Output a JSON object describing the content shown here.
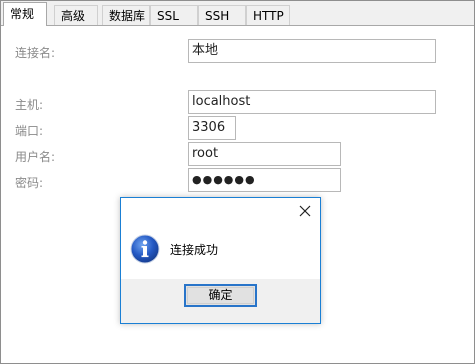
{
  "tabs": [
    {
      "label": "常规",
      "active": true
    },
    {
      "label": "高级",
      "active": false
    },
    {
      "label": "数据库",
      "active": false
    },
    {
      "label": "SSL",
      "active": false
    },
    {
      "label": "SSH",
      "active": false
    },
    {
      "label": "HTTP",
      "active": false
    }
  ],
  "form": {
    "connection_name_label": "连接名:",
    "connection_name_value": "本地",
    "host_label": "主机:",
    "host_value": "localhost",
    "port_label": "端口:",
    "port_value": "3306",
    "username_label": "用户名:",
    "username_value": "root",
    "password_label": "密码:",
    "password_value": "●●●●●●"
  },
  "dialog": {
    "message": "连接成功",
    "ok_label": "确定",
    "icon": "info-icon",
    "close_icon": "close-icon"
  },
  "colors": {
    "dialog_border": "#1a7fd4",
    "ok_button_border": "#2874c9",
    "info_icon_blue": "#1f4fb0"
  }
}
